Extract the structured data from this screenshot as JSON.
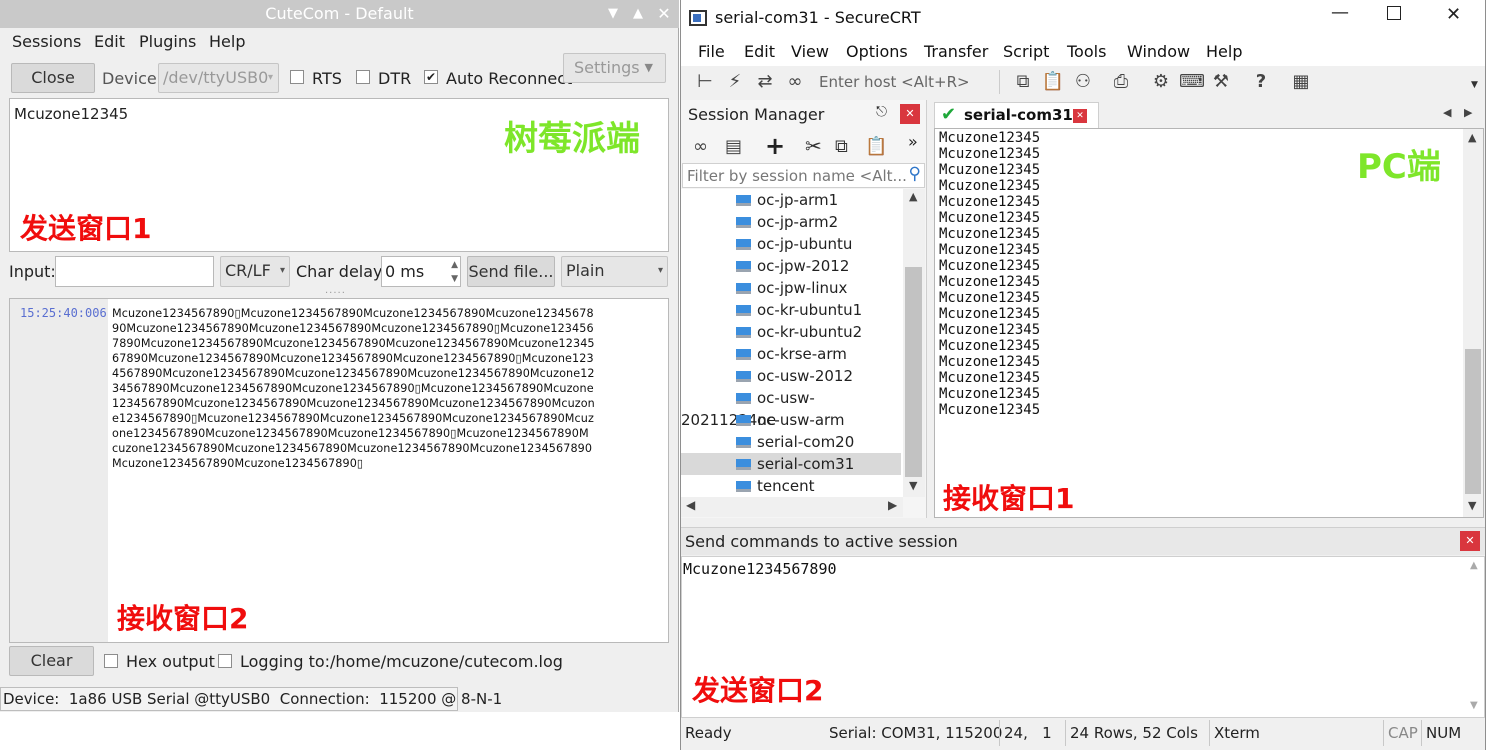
{
  "cutecom": {
    "window_title": "CuteCom - Default",
    "menu": [
      "Sessions",
      "Edit",
      "Plugins",
      "Help"
    ],
    "close_button": "Close",
    "device_label": "Device:",
    "device_value": "/dev/ttyUSB0",
    "rts_label": "RTS",
    "dtr_label": "DTR",
    "auto_reconnect_label": "Auto Reconnect",
    "settings_label": "Settings",
    "send_text": "Mcuzone12345",
    "annotation_title": "树莓派端",
    "annotation_send": "发送窗口1",
    "input_label": "Input:",
    "line_end": "CR/LF",
    "char_delay_label": "Char delay:",
    "char_delay_value": "0 ms",
    "send_file_button": "Send file...",
    "format": "Plain",
    "timestamp": "15:25:40:006",
    "received_lines": [
      "Mcuzone1234567890▯Mcuzone1234567890Mcuzone1234567890Mcuzone12345678",
      "90Mcuzone1234567890Mcuzone1234567890Mcuzone1234567890▯Mcuzone123456",
      "7890Mcuzone1234567890Mcuzone1234567890Mcuzone1234567890Mcuzone12345",
      "67890Mcuzone1234567890Mcuzone1234567890Mcuzone1234567890▯Mcuzone123",
      "4567890Mcuzone1234567890Mcuzone1234567890Mcuzone1234567890Mcuzone12",
      "34567890Mcuzone1234567890Mcuzone1234567890▯Mcuzone1234567890Mcuzone",
      "1234567890Mcuzone1234567890Mcuzone1234567890Mcuzone1234567890Mcuzon",
      "e1234567890▯Mcuzone1234567890Mcuzone1234567890Mcuzone1234567890Mcuz",
      "one1234567890Mcuzone1234567890Mcuzone1234567890▯Mcuzone1234567890M",
      "cuzone1234567890Mcuzone1234567890Mcuzone1234567890Mcuzone1234567890",
      "Mcuzone1234567890Mcuzone1234567890▯"
    ],
    "annotation_receive": "接收窗口2",
    "clear_button": "Clear",
    "hex_output_label": "Hex output",
    "logging_label": "Logging to:",
    "log_path": "/home/mcuzone/cutecom.log",
    "status_bar": "Device:  1a86 USB Serial @ttyUSB0  Connection:  115200 @ 8-N-1"
  },
  "securecrt": {
    "window_title": "serial-com31 - SecureCRT",
    "menu": [
      "File",
      "Edit",
      "View",
      "Options",
      "Transfer",
      "Script",
      "Tools",
      "Window",
      "Help"
    ],
    "enter_host_placeholder": "Enter host <Alt+R>",
    "session_manager_title": "Session Manager",
    "filter_placeholder": "Filter by session name <Alt...",
    "sessions": [
      "oc-jp-arm1",
      "oc-jp-arm2",
      "oc-jp-ubuntu",
      "oc-jpw-2012",
      "oc-jpw-linux",
      "oc-kr-ubuntu1",
      "oc-kr-ubuntu2",
      "oc-krse-arm",
      "oc-usw-2012",
      "oc-usw-20211224ne",
      "oc-usw-arm",
      "serial-com20",
      "serial-com31",
      "tencent"
    ],
    "selected_session": "serial-com31",
    "tab_label": "serial-com31",
    "terminal_lines": [
      "Mcuzone12345",
      "Mcuzone12345",
      "Mcuzone12345",
      "Mcuzone12345",
      "Mcuzone12345",
      "Mcuzone12345",
      "Mcuzone12345",
      "Mcuzone12345",
      "Mcuzone12345",
      "Mcuzone12345",
      "Mcuzone12345",
      "Mcuzone12345",
      "Mcuzone12345",
      "Mcuzone12345",
      "Mcuzone12345",
      "Mcuzone12345",
      "Mcuzone12345",
      "Mcuzone12345"
    ],
    "annotation_pc": "PC端",
    "annotation_receive": "接收窗口1",
    "send_commands_title": "Send commands to active session",
    "command_text": "Mcuzone1234567890",
    "annotation_send": "发送窗口2",
    "status": {
      "ready": "Ready",
      "serial": "Serial: COM31, 115200",
      "position": "24,   1",
      "size": "24 Rows, 52 Cols",
      "term": "Xterm",
      "cap": "CAP",
      "num": "NUM"
    }
  },
  "colors": {
    "annotation_red": "#f00d0d",
    "annotation_green": "#7ee62a",
    "timestamp_blue": "#5a6fd1",
    "close_red": "#d9363e",
    "selection_grey": "#d9d9d9"
  }
}
